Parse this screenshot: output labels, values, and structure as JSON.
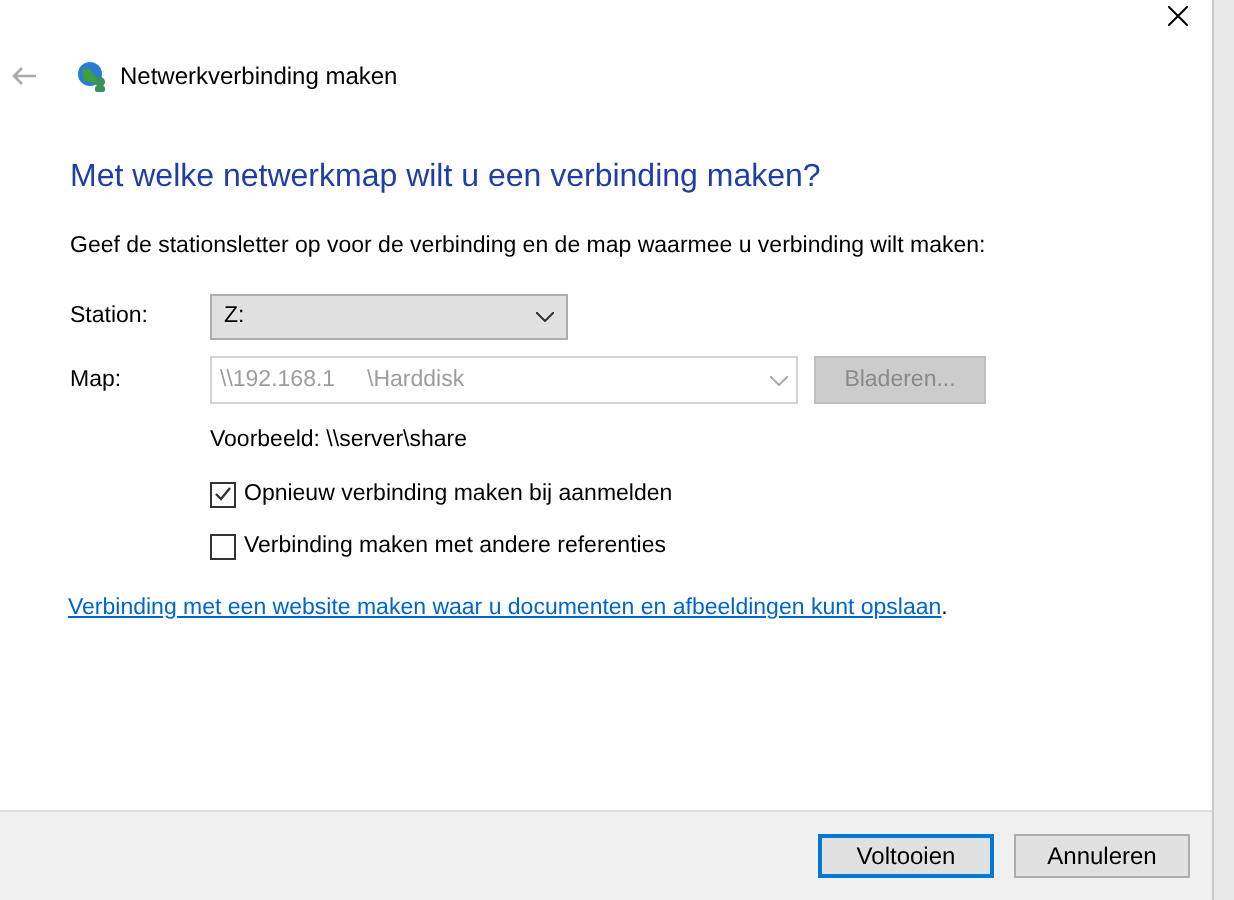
{
  "window": {
    "title": "Netwerkverbinding maken"
  },
  "heading": "Met welke netwerkmap wilt u een verbinding maken?",
  "instruction": "Geef de stationsletter op voor de verbinding en de map waarmee u verbinding wilt maken:",
  "station": {
    "label": "Station:",
    "value": "Z:"
  },
  "map": {
    "label": "Map:",
    "value": "\\\\192.168.1     \\Harddisk",
    "disabled": true,
    "browse": "Bladeren..."
  },
  "example": "Voorbeeld: \\\\server\\share",
  "options": [
    {
      "label": "Opnieuw verbinding maken bij aanmelden",
      "checked": true
    },
    {
      "label": "Verbinding maken met andere referenties",
      "checked": false
    }
  ],
  "link": {
    "text": "Verbinding met een website maken waar u documenten en afbeeldingen kunt opslaan",
    "suffix": "."
  },
  "buttons": [
    {
      "label": "Voltooien",
      "selected": true
    },
    {
      "label": "Annuleren",
      "selected": false
    }
  ]
}
